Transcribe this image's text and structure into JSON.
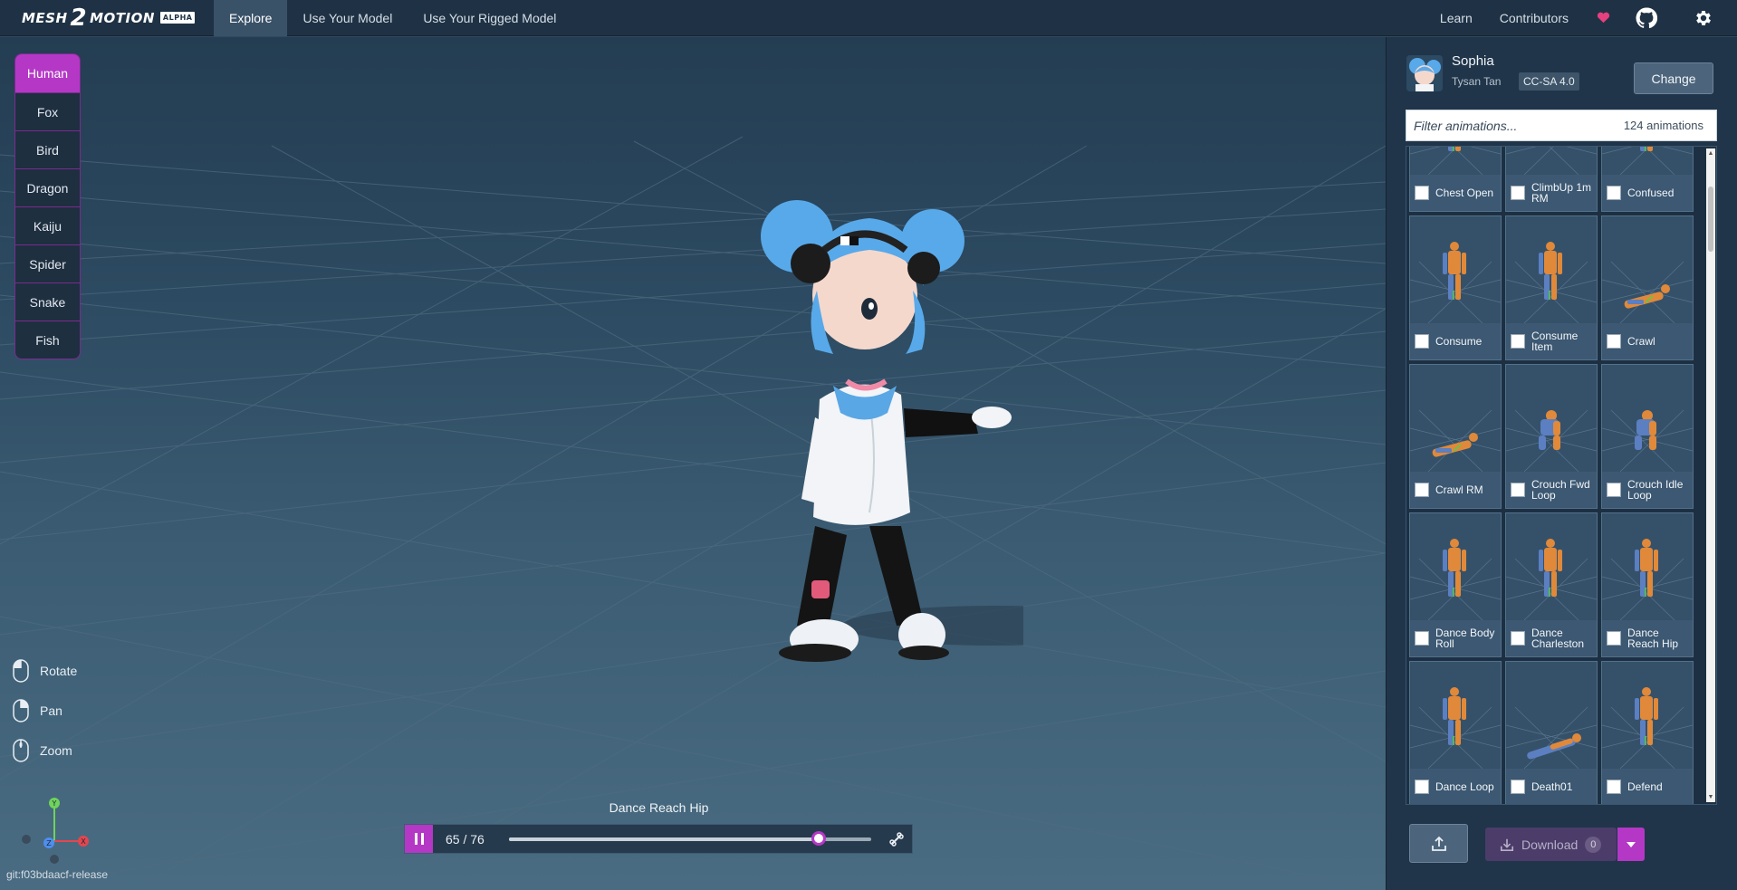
{
  "app": {
    "logo": {
      "part1": "MESH",
      "part2": "2",
      "part3": "MOTION",
      "badge": "ALPHA"
    },
    "nav_tabs": [
      {
        "label": "Explore",
        "active": true
      },
      {
        "label": "Use Your Model",
        "active": false
      },
      {
        "label": "Use Your Rigged Model",
        "active": false
      }
    ],
    "nav_right": {
      "learn": "Learn",
      "contributors": "Contributors"
    },
    "icons": {
      "heart": "heart-icon",
      "github": "github-icon",
      "settings": "gear-icon"
    },
    "accent_color": "#b438c5"
  },
  "species": [
    {
      "label": "Human",
      "active": true
    },
    {
      "label": "Fox"
    },
    {
      "label": "Bird"
    },
    {
      "label": "Dragon"
    },
    {
      "label": "Kaiju"
    },
    {
      "label": "Spider"
    },
    {
      "label": "Snake"
    },
    {
      "label": "Fish"
    }
  ],
  "controls": [
    {
      "label": "Rotate",
      "icon": "mouse-left-icon"
    },
    {
      "label": "Pan",
      "icon": "mouse-right-icon"
    },
    {
      "label": "Zoom",
      "icon": "mouse-wheel-icon"
    }
  ],
  "gizmo": {
    "x": "X",
    "y": "Y",
    "z": "Z"
  },
  "git_version": "git:f03bdaacf-release",
  "playback": {
    "animation_name": "Dance Reach Hip",
    "frame_label": "65 / 76",
    "current_frame": 65,
    "total_frames": 76,
    "playing": true
  },
  "model": {
    "name": "Sophia",
    "author": "Tysan Tan",
    "license": "CC-SA 4.0",
    "change_label": "Change"
  },
  "filter": {
    "placeholder": "Filter animations...",
    "count_label": "124 animations"
  },
  "animations": [
    {
      "label": "Chest Open",
      "pose": "stand"
    },
    {
      "label": "ClimbUp 1m RM",
      "pose": "floor-small"
    },
    {
      "label": "Confused",
      "pose": "stand"
    },
    {
      "label": "Consume",
      "pose": "stand"
    },
    {
      "label": "Consume Item",
      "pose": "stand"
    },
    {
      "label": "Crawl",
      "pose": "crawl"
    },
    {
      "label": "Crawl RM",
      "pose": "crawl"
    },
    {
      "label": "Crouch Fwd Loop",
      "pose": "crouch"
    },
    {
      "label": "Crouch Idle Loop",
      "pose": "crouch"
    },
    {
      "label": "Dance Body Roll",
      "pose": "stand"
    },
    {
      "label": "Dance Charleston",
      "pose": "stand"
    },
    {
      "label": "Dance Reach Hip",
      "pose": "stand"
    },
    {
      "label": "Dance Loop",
      "pose": "stand"
    },
    {
      "label": "Death01",
      "pose": "lying"
    },
    {
      "label": "Defend",
      "pose": "stand"
    }
  ],
  "download": {
    "label": "Download",
    "count": "0"
  }
}
